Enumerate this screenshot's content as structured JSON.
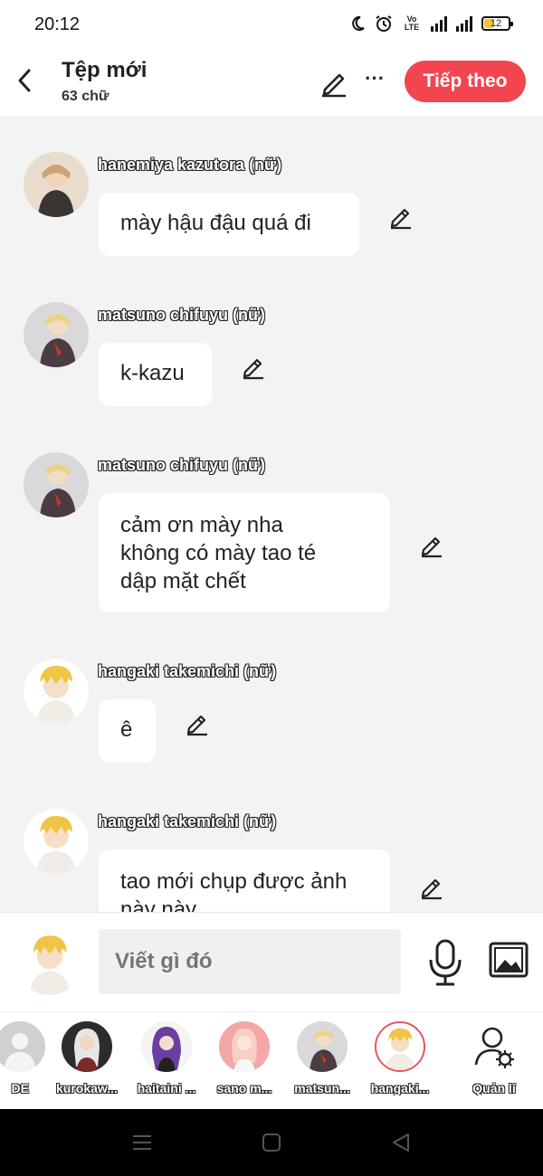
{
  "status": {
    "time": "20:12",
    "volte": "Vo LTE",
    "battery": "12"
  },
  "header": {
    "title": "Tệp mới",
    "subtitle": "63 chữ",
    "next_label": "Tiếp theo"
  },
  "messages": [
    {
      "sender": "hanemiya kazutora (nữ)",
      "text": "mày hậu đậu quá đi"
    },
    {
      "sender": "matsuno chifuyu (nữ)",
      "text": "k-kazu"
    },
    {
      "sender": "matsuno chifuyu (nữ)",
      "text": "cảm ơn mày nha\nkhông có mày tao té\ndập mặt chết"
    },
    {
      "sender": "hangaki takemichi (nữ)",
      "text": "ê"
    },
    {
      "sender": "hangaki takemichi (nữ)",
      "text": "tao mới chụp được ảnh\nnày này"
    }
  ],
  "composer": {
    "placeholder": "Viết gì đó"
  },
  "characters": [
    {
      "label": "DE"
    },
    {
      "label": "kurokaw..."
    },
    {
      "label": "haitaini ..."
    },
    {
      "label": "sano m..."
    },
    {
      "label": "matsun..."
    },
    {
      "label": "hangaki..."
    },
    {
      "label": "Quản lí"
    }
  ],
  "icons": {
    "back": "chevron-left-icon",
    "edit": "pencil-icon",
    "more": "more-horizontal-icon",
    "mic": "microphone-icon",
    "image": "image-icon",
    "manage": "user-gear-icon"
  },
  "colors": {
    "accent": "#f2454f",
    "background": "#f3f3f3",
    "bubble": "#ffffff"
  }
}
